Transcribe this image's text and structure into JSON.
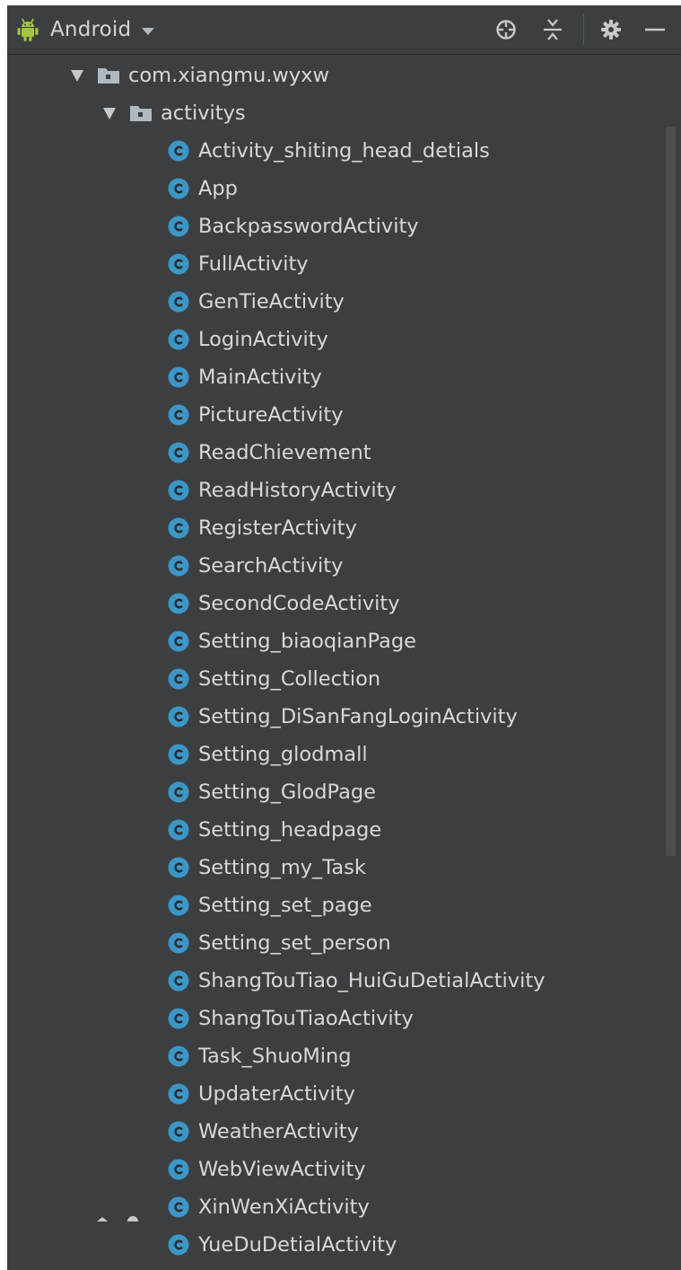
{
  "toolbar": {
    "view_label": "Android",
    "icons": [
      "android-icon",
      "chevron-down-icon",
      "crosshair-icon",
      "collapse-all-icon",
      "gear-icon",
      "minimize-icon"
    ]
  },
  "tree": {
    "package": "com.xiangmu.wyxw",
    "folder": "activitys",
    "classes": [
      "Activity_shiting_head_detials",
      "App",
      "BackpasswordActivity",
      "FullActivity",
      "GenTieActivity",
      "LoginActivity",
      "MainActivity",
      "PictureActivity",
      "ReadChievement",
      "ReadHistoryActivity",
      "RegisterActivity",
      "SearchActivity",
      "SecondCodeActivity",
      "Setting_biaoqianPage",
      "Setting_Collection",
      "Setting_DiSanFangLoginActivity",
      "Setting_glodmall",
      "Setting_GlodPage",
      "Setting_headpage",
      "Setting_my_Task",
      "Setting_set_page",
      "Setting_set_person",
      "ShangTouTiao_HuiGuDetialActivity",
      "ShangTouTiaoActivity",
      "Task_ShuoMing",
      "UpdaterActivity",
      "WeatherActivity",
      "WebViewActivity",
      "XinWenXiActivity",
      "YueDuDetialActivity"
    ]
  },
  "colors": {
    "panel_bg": "#3c3f41",
    "text": "#d8d8d8",
    "class_icon": "#3c97c9",
    "android_green": "#a4c639",
    "folder": "#aeb9c0"
  }
}
